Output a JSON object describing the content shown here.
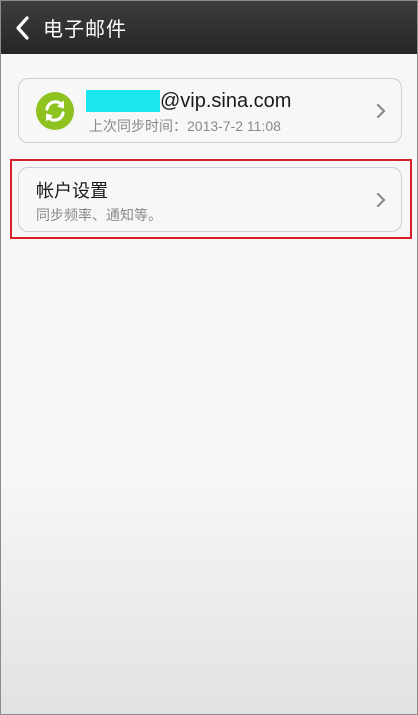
{
  "header": {
    "title": "电子邮件",
    "back_icon": "chevron-left-icon"
  },
  "account": {
    "email_domain": "@vip.sina.com",
    "last_sync": "上次同步时间：2013-7-2 11:08",
    "icon": "sync-icon",
    "icon_color": "#8dc21f",
    "redaction_color": "#19e6ee"
  },
  "settings": {
    "title": "帐户设置",
    "subtitle": "同步频率、通知等。",
    "highlight_color": "#d8202a"
  }
}
